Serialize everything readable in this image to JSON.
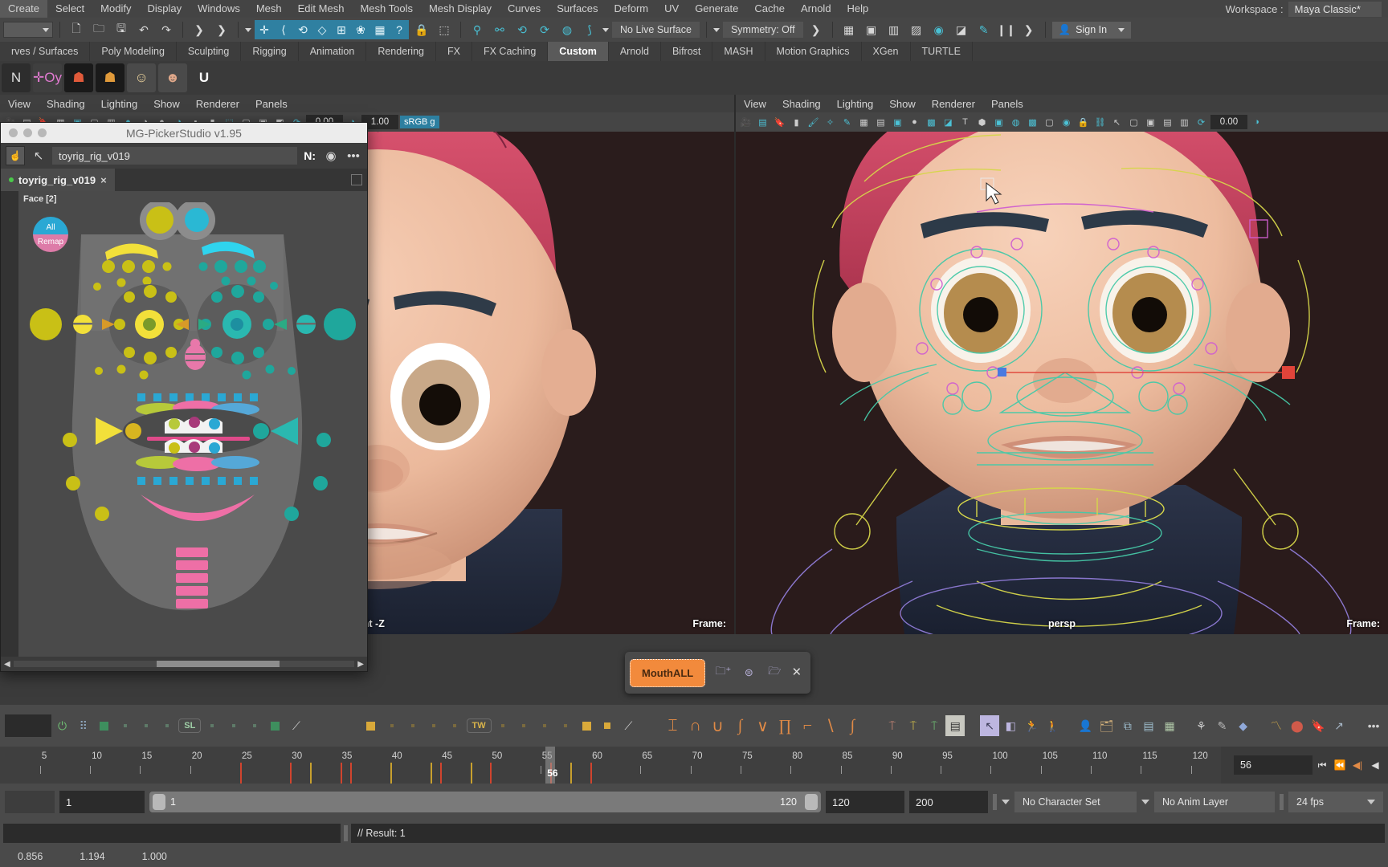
{
  "menubar": {
    "items": [
      "Create",
      "Select",
      "Modify",
      "Display",
      "Windows",
      "Mesh",
      "Edit Mesh",
      "Mesh Tools",
      "Mesh Display",
      "Curves",
      "Surfaces",
      "Deform",
      "UV",
      "Generate",
      "Cache",
      "Arnold",
      "Help"
    ],
    "workspace_label": "Workspace :",
    "workspace_value": "Maya Classic*"
  },
  "statusbar": {
    "live_surface": "No Live Surface",
    "symmetry": "Symmetry: Off",
    "sign_in": "Sign In"
  },
  "shelf_tabs": {
    "items": [
      "rves / Surfaces",
      "Poly Modeling",
      "Sculpting",
      "Rigging",
      "Animation",
      "Rendering",
      "FX",
      "FX Caching",
      "Custom",
      "Arnold",
      "Bifrost",
      "MASH",
      "Motion Graphics",
      "XGen",
      "TURTLE"
    ],
    "active": "Custom"
  },
  "shelf_icons": [
    "icon-rig-n",
    "icon-plus-oy",
    "icon-biped-red",
    "icon-biped-orange",
    "icon-girl-face",
    "icon-troll-head",
    "icon-magnet-u"
  ],
  "viewport_left": {
    "menu": [
      "View",
      "Shading",
      "Lighting",
      "Show",
      "Renderer",
      "Panels"
    ],
    "label": "front -Z",
    "frame_label": "Frame:",
    "numfield_a": "0.00",
    "numfield_b": "1.00",
    "color_space": "sRGB g"
  },
  "viewport_right": {
    "menu": [
      "View",
      "Shading",
      "Lighting",
      "Show",
      "Renderer",
      "Panels"
    ],
    "label": "persp",
    "frame_label": "Frame:",
    "numfield_a": "0.00"
  },
  "picker": {
    "window_title": "MG-PickerStudio v1.95",
    "path_value": "toyrig_rig_v019",
    "n_label": "N:",
    "tab_label": "toyrig_rig_v019",
    "tab_close": "×",
    "face_tag": "Face [2]",
    "all_remap_top": "All",
    "all_remap_bottom": "Remap"
  },
  "mouth_popup": {
    "button_label": "MouthALL",
    "icons": [
      "add-folder-icon",
      "select-set-icon",
      "toggle-folder-icon"
    ],
    "close": "×"
  },
  "anim_toolbar": {
    "pill_sl": "SL",
    "pill_tw": "TW",
    "tangents": [
      "⌶",
      "∩",
      "∪",
      "∫",
      "∨",
      "∏",
      "⌐",
      "∖",
      "∫"
    ]
  },
  "timeline": {
    "ticks": [
      5,
      10,
      15,
      20,
      25,
      30,
      35,
      40,
      45,
      50,
      55,
      60,
      65,
      70,
      75,
      80,
      85,
      90,
      95,
      100,
      105,
      110,
      115,
      120
    ],
    "current_frame": 56,
    "current_frame_field": "56",
    "range_start_small": "1",
    "range_slider_start": "1",
    "range_slider_end": "120",
    "end_field": "120",
    "max_field": "200",
    "character_set": "No Character Set",
    "anim_layer": "No Anim Layer",
    "fps": "24 fps",
    "keys_red": [
      25,
      30,
      35,
      36,
      45,
      50,
      56,
      60
    ],
    "keys_yellow": [
      32,
      40,
      44,
      48,
      58
    ]
  },
  "command_line": {
    "output": "// Result: 1"
  },
  "help_line": {
    "values": [
      "0.856",
      "1.194",
      "1.000"
    ]
  }
}
